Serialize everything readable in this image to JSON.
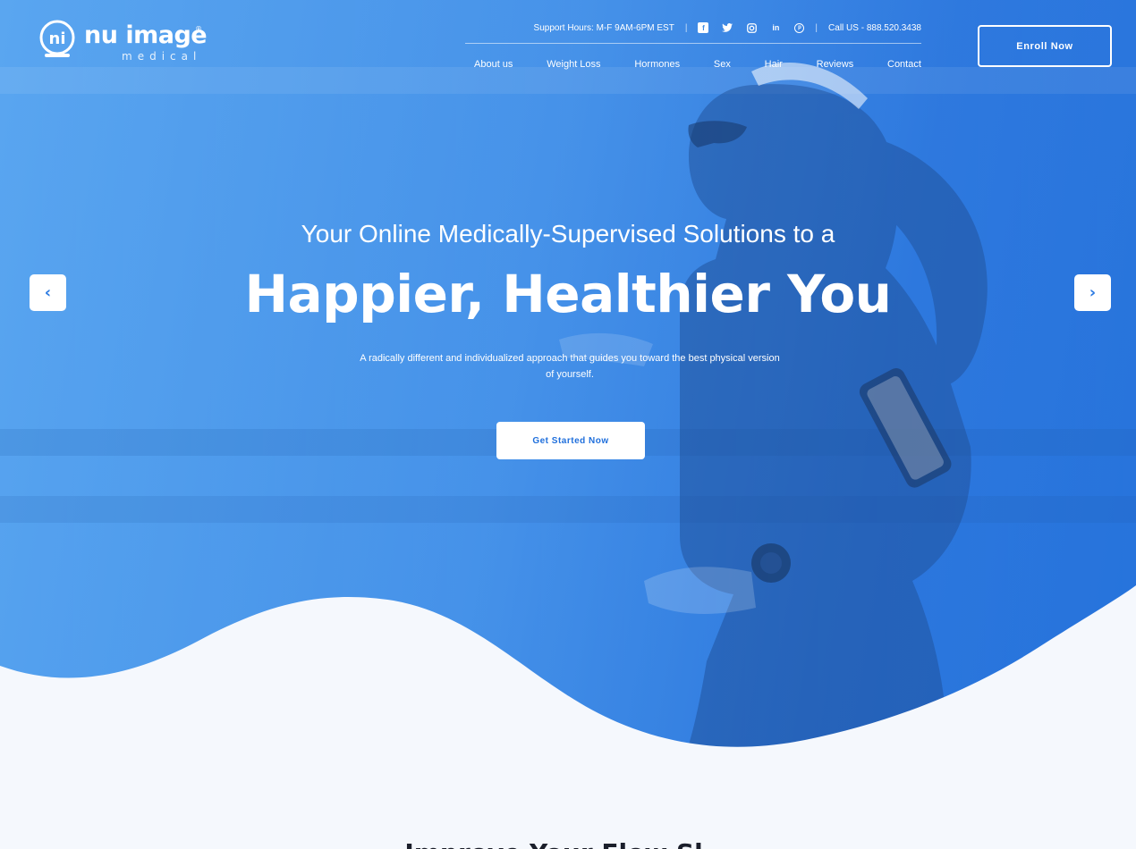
{
  "brand": {
    "name": "nu image",
    "sub": "medical",
    "reg_mark": "®",
    "mark_letters": "ni"
  },
  "topbar": {
    "support_hours": "Support Hours: M-F 9AM-6PM EST",
    "call": "Call US - 888.520.3438",
    "social_icons": [
      "facebook-icon",
      "twitter-icon",
      "instagram-icon",
      "linkedin-icon",
      "pinterest-icon"
    ]
  },
  "nav": {
    "items": [
      "About us",
      "Weight Loss",
      "Hormones",
      "Sex",
      "Hair",
      "Reviews",
      "Contact"
    ]
  },
  "enroll_label": "Enroll Now",
  "hero": {
    "subheading": "Your Online Medically-Supervised Solutions to a",
    "headline": "Happier, Healthier You",
    "description": "A radically different and individualized approach that guides you toward the best physical version of yourself.",
    "cta_label": "Get Started Now",
    "prev_arrow": "‹",
    "next_arrow": "›"
  },
  "next_section": {
    "heading": "Improve Your Flow Sl..."
  },
  "colors": {
    "accent": "#1f6fdc",
    "hero_light": "#5aa6f0",
    "background": "#f5f8fd",
    "text_dark": "#1b1f2b"
  }
}
